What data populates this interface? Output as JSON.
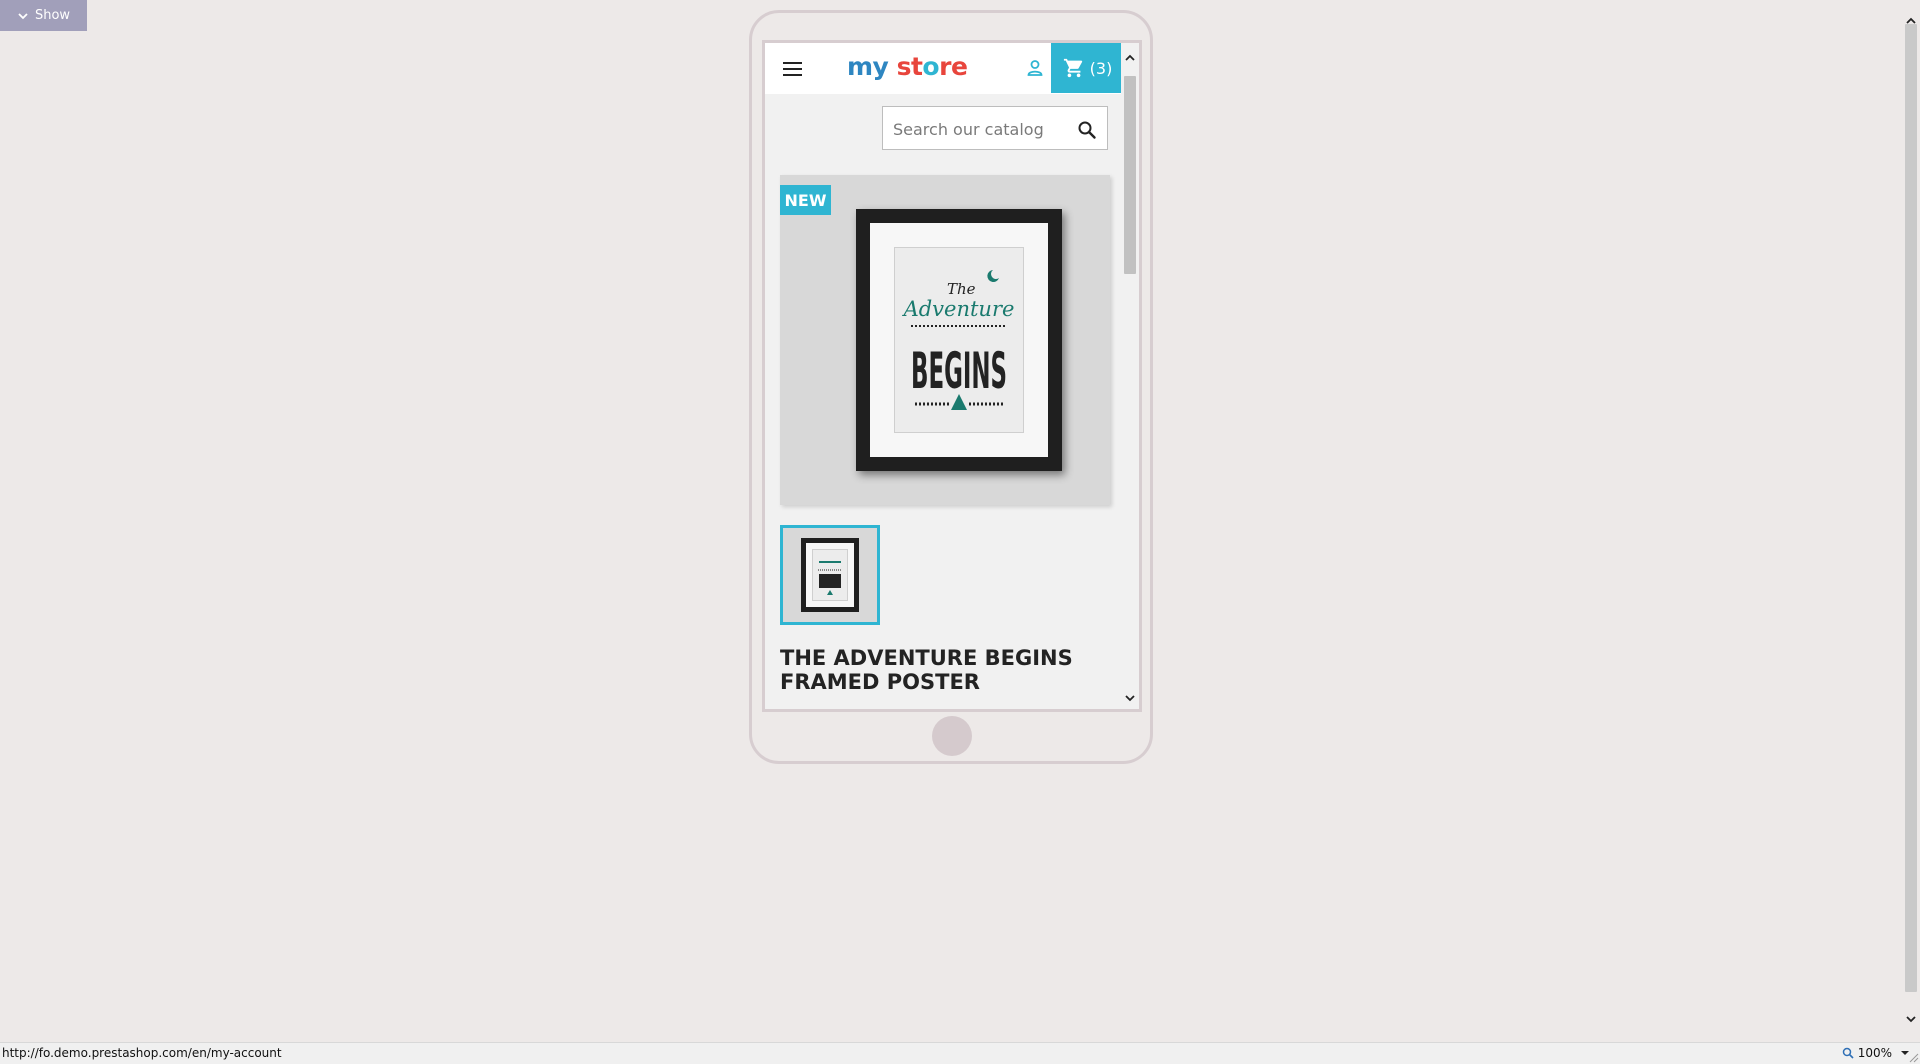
{
  "toolbar": {
    "show_label": "Show",
    "show_icon": "chevron-down-icon"
  },
  "store": {
    "logo_parts": [
      "my",
      " ",
      "st",
      "o",
      "re"
    ],
    "cart_count": "(3)",
    "search_placeholder": "Search our catalog",
    "badge": "NEW",
    "product_title": "THE ADVENTURE BEGINS FRAMED POSTER",
    "poster_text": {
      "the": "The",
      "adventure": "Adventure",
      "begins": "BEGINS"
    },
    "colors": {
      "accent": "#2fb5d2",
      "logo_blue": "#2e86c1",
      "logo_navy": "#3b3b8a",
      "logo_red": "#e8453c"
    }
  },
  "status_bar": {
    "url": "http://fo.demo.prestashop.com/en/my-account",
    "zoom": "100%"
  }
}
